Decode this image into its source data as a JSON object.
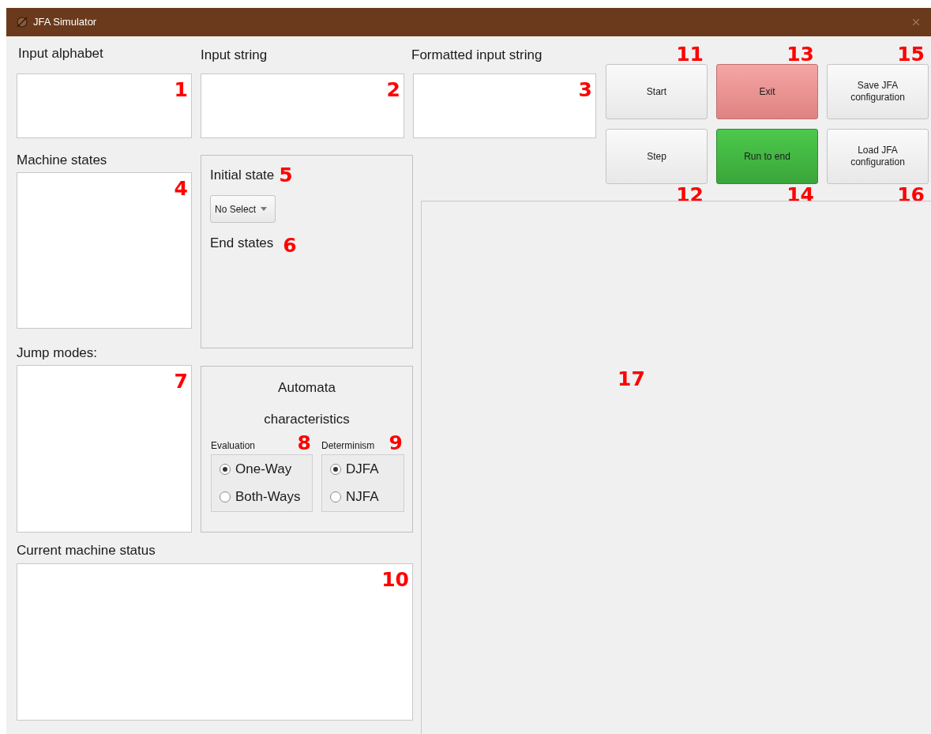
{
  "window": {
    "title": "JFA Simulator"
  },
  "input_alphabet": {
    "label": "Input alphabet",
    "marker": "1"
  },
  "input_string": {
    "label": "Input string",
    "marker": "2"
  },
  "formatted_input_string": {
    "label": "Formatted input string",
    "marker": "3"
  },
  "machine_states": {
    "label": "Machine states",
    "marker": "4"
  },
  "states_group": {
    "initial_state": {
      "label": "Initial state",
      "marker": "5",
      "dropdown": "No Select"
    },
    "end_states": {
      "label": "End states",
      "marker": "6"
    }
  },
  "jump_modes": {
    "label": "Jump modes:",
    "marker": "7"
  },
  "characteristics": {
    "title_lines": [
      "Automata",
      "characteristics"
    ],
    "groups": [
      {
        "label": "Evaluation",
        "marker": "8",
        "options": [
          {
            "label": "One-Way",
            "selected": true
          },
          {
            "label": "Both-Ways",
            "selected": false
          }
        ]
      },
      {
        "label": "Determinism",
        "marker": "9",
        "options": [
          {
            "label": "DJFA",
            "selected": true
          },
          {
            "label": "NJFA",
            "selected": false
          }
        ]
      }
    ]
  },
  "status": {
    "label": "Current machine status",
    "marker": "10"
  },
  "buttons": [
    {
      "label": "Start",
      "kind": "plain",
      "marker": "11",
      "marker_below": false
    },
    {
      "label": "Exit",
      "kind": "danger",
      "marker": "13",
      "marker_below": false
    },
    {
      "label": "Save JFA configuration",
      "kind": "plain",
      "marker": "15",
      "marker_below": false
    },
    {
      "label": "Step",
      "kind": "plain",
      "marker": "12",
      "marker_below": true
    },
    {
      "label": "Run to end",
      "kind": "success",
      "marker": "14",
      "marker_below": true
    },
    {
      "label": "Load JFA configuration",
      "kind": "plain",
      "marker": "16",
      "marker_below": true
    }
  ],
  "diagram_panel": {
    "marker": "17"
  }
}
